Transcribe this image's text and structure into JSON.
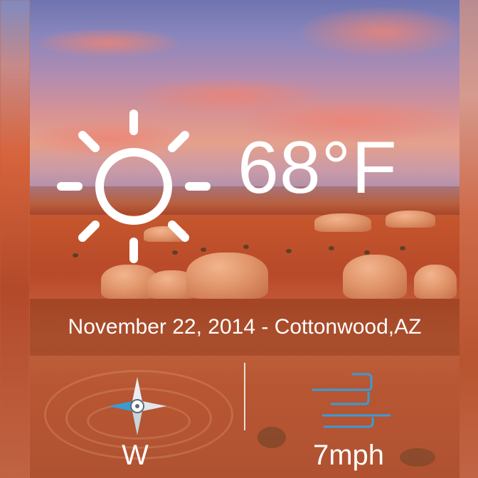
{
  "weather": {
    "condition_icon": "sun-icon",
    "temperature": "68°F"
  },
  "info_bar": {
    "date_location": "November 22, 2014 - Cottonwood,AZ"
  },
  "wind": {
    "direction_icon": "compass-icon",
    "direction": "W",
    "speed_icon": "wind-icon",
    "speed": "7mph"
  },
  "colors": {
    "text": "#ffffff",
    "wind_accent": "#3a9bd5",
    "bar_overlay": "#8a361a"
  }
}
